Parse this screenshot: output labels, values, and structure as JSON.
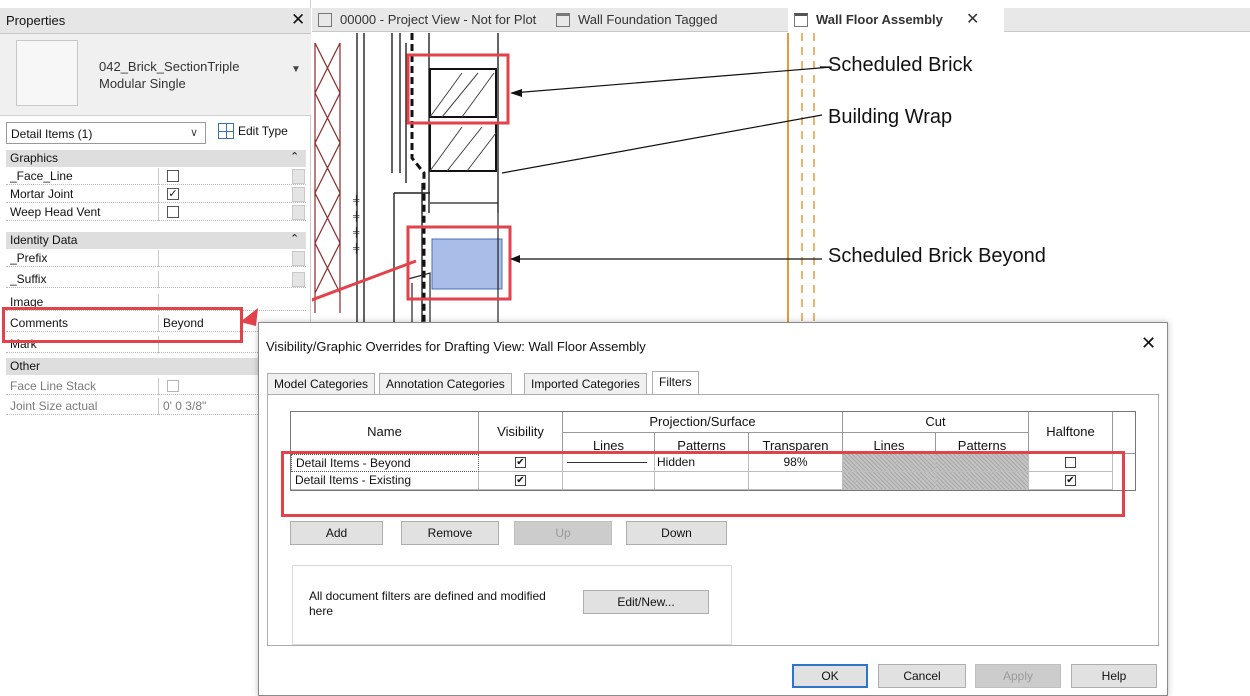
{
  "properties": {
    "title": "Properties",
    "type_name": "042_Brick_SectionTriple Modular Single",
    "selector": "Detail Items (1)",
    "edit_type": "Edit Type",
    "groups": [
      {
        "name": "Graphics",
        "rows": [
          {
            "name": "_Face_Line",
            "checkbox": true,
            "checked": false
          },
          {
            "name": "Mortar Joint",
            "checkbox": true,
            "checked": true
          },
          {
            "name": "Weep Head Vent",
            "checkbox": true,
            "checked": false
          }
        ]
      },
      {
        "name": "Identity Data",
        "rows": [
          {
            "name": "_Prefix",
            "value": ""
          },
          {
            "name": "_Suffix",
            "value": ""
          },
          {
            "name": "Image",
            "value": ""
          },
          {
            "name": "Comments",
            "value": "Beyond"
          },
          {
            "name": "Mark",
            "value": ""
          }
        ]
      },
      {
        "name": "Other",
        "rows": [
          {
            "name": "Face Line Stack",
            "checkbox": true,
            "checked": false,
            "disabled": true
          },
          {
            "name": "Joint Size actual",
            "value": "0'  0 3/8\"",
            "disabled": true
          }
        ]
      }
    ]
  },
  "tabs": [
    {
      "label": "00000 - Project View - Not for Plot",
      "icon": "sheet-icon"
    },
    {
      "label": "Wall Foundation Tagged",
      "icon": "drafting-view-icon"
    },
    {
      "label": "Wall Floor Assembly",
      "icon": "drafting-view-icon",
      "active": true
    }
  ],
  "callouts": {
    "scheduled_brick": "Scheduled Brick",
    "building_wrap": "Building Wrap",
    "scheduled_brick_beyond": "Scheduled Brick Beyond"
  },
  "dialog": {
    "title": "Visibility/Graphic Overrides for Drafting View: Wall Floor Assembly",
    "tabs": [
      "Model Categories",
      "Annotation Categories",
      "Imported Categories",
      "Filters"
    ],
    "active_tab": "Filters",
    "columns": {
      "name": "Name",
      "visibility": "Visibility",
      "projection_surface": "Projection/Surface",
      "cut": "Cut",
      "halftone": "Halftone",
      "lines": "Lines",
      "patterns": "Patterns",
      "transparency": "Transparen"
    },
    "rows": [
      {
        "name": "Detail Items - Beyond",
        "visibility": true,
        "proj_pattern": "Hidden",
        "transparency": "98%",
        "halftone": false
      },
      {
        "name": "Detail Items - Existing",
        "visibility": true,
        "proj_pattern": "",
        "transparency": "",
        "halftone": true
      }
    ],
    "buttons": {
      "add": "Add",
      "remove": "Remove",
      "up": "Up",
      "down": "Down"
    },
    "info_text": "All document filters are defined and modified here",
    "edit_new": "Edit/New...",
    "footer": {
      "ok": "OK",
      "cancel": "Cancel",
      "apply": "Apply",
      "help": "Help"
    }
  },
  "colors": {
    "highlight": "#e2424a",
    "selected_fill": "#a9bde8",
    "accent": "#2f74c8",
    "section_line": "#8b2a2a"
  }
}
